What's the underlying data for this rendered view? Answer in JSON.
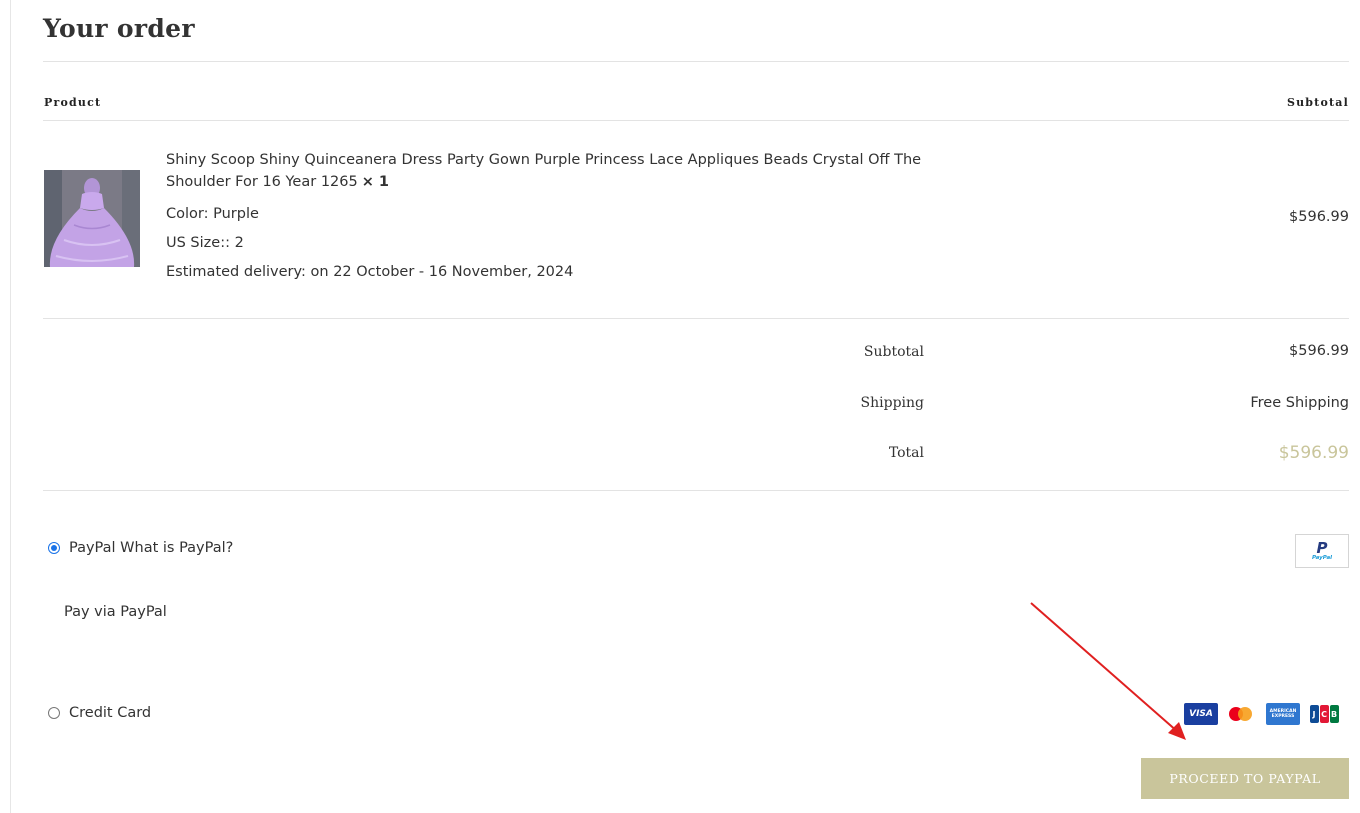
{
  "order": {
    "title": "Your order",
    "headers": {
      "product": "Product",
      "subtotal": "Subtotal"
    },
    "item": {
      "name": "Shiny Scoop Shiny Quinceanera Dress Party Gown Purple Princess Lace Appliques Beads Crystal Off The Shoulder For 16 Year 1265",
      "quantity": "× 1",
      "color": "Color: Purple",
      "size": "US Size:: 2",
      "delivery": "Estimated delivery: on 22 October - 16 November, 2024",
      "price": "$596.99"
    },
    "totals": {
      "subtotal_label": "Subtotal",
      "subtotal_value": "$596.99",
      "shipping_label": "Shipping",
      "shipping_value": "Free Shipping",
      "total_label": "Total",
      "total_value": "$596.99"
    }
  },
  "payment": {
    "paypal": {
      "label": "PayPal What is PayPal?",
      "description": "Pay via PayPal",
      "selected": true,
      "badge_word": "PayPal"
    },
    "credit_card": {
      "label": "Credit Card",
      "selected": false
    },
    "card_logos": {
      "visa": "VISA",
      "amex": "AMERICAN EXPRESS",
      "jcb": [
        "J",
        "C",
        "B"
      ]
    },
    "proceed_button": "PROCEED TO PAYPAL"
  },
  "colors": {
    "accent": "#c9c59b",
    "radio_selected": "#1a73e8",
    "annotation_arrow": "#e02020",
    "dress": "#c3a3e6"
  },
  "icons": [
    "product-thumbnail-image",
    "paypal-logo-icon",
    "visa-icon",
    "mastercard-icon",
    "amex-icon",
    "jcb-icon",
    "annotation-arrow-icon"
  ]
}
